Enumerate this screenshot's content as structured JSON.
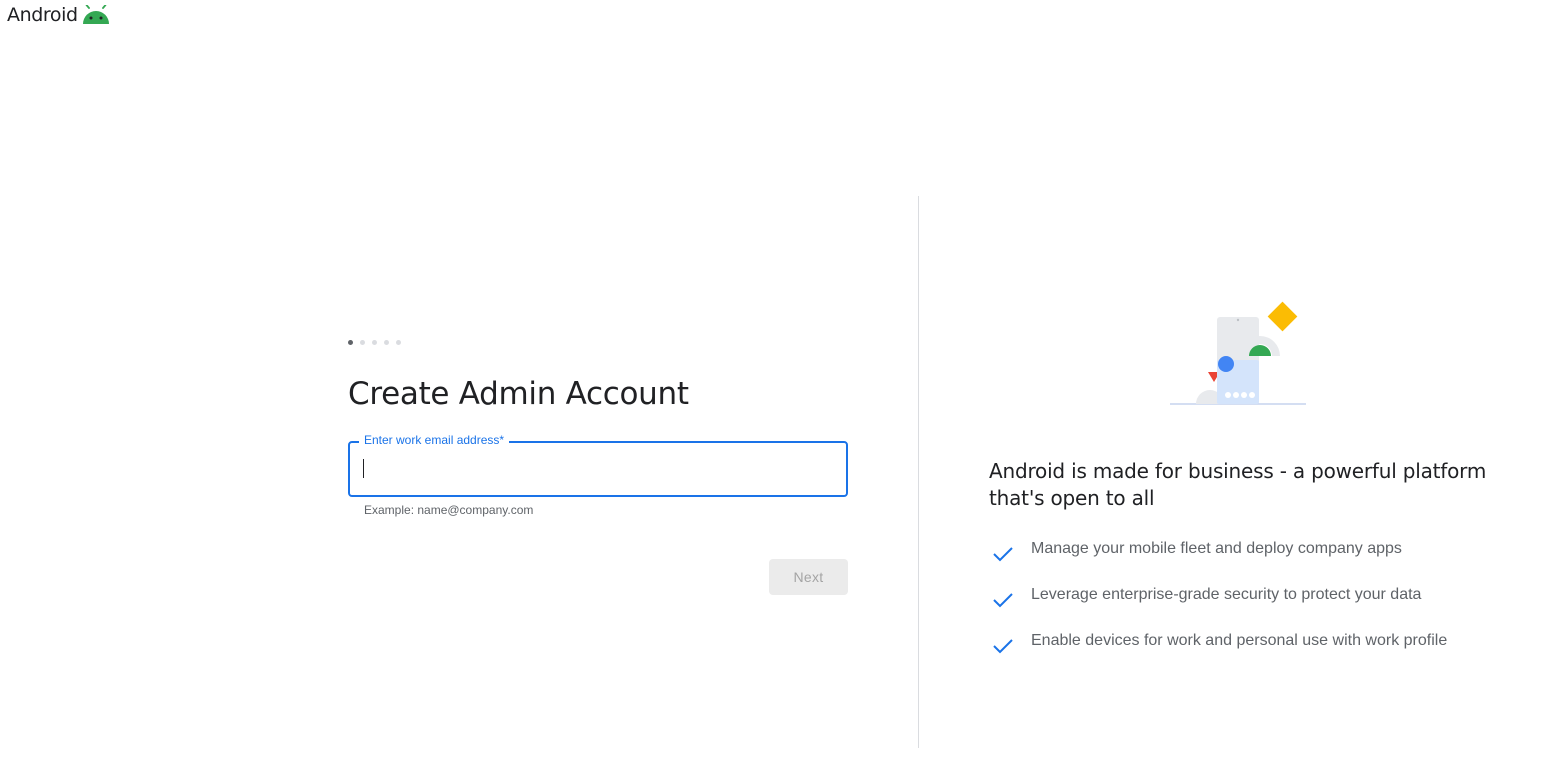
{
  "header": {
    "logo_text": "Android",
    "logo_icon": "android-bot-icon",
    "brand_color": "#34a853"
  },
  "form": {
    "stepper": {
      "total_steps": 5,
      "current_step": 1
    },
    "title": "Create Admin Account",
    "email_field": {
      "label": "Enter work email address*",
      "value": "",
      "placeholder": "",
      "helper": "Example: name@company.com"
    },
    "next_button": {
      "label": "Next",
      "enabled": false
    }
  },
  "promo": {
    "title": "Android is made for business - a powerful platform that's open to all",
    "features": [
      {
        "icon": "check-icon",
        "text": "Manage your mobile fleet and deploy company apps"
      },
      {
        "icon": "check-icon",
        "text": "Leverage enterprise-grade security to protect your data"
      },
      {
        "icon": "check-icon",
        "text": "Enable devices for work and personal use with work profile"
      }
    ]
  },
  "colors": {
    "accent": "#1a73e8",
    "text_primary": "#202124",
    "text_secondary": "#5f6368",
    "divider": "#dadce0",
    "button_disabled_bg": "#ebebeb",
    "button_disabled_text": "#a4a4a4"
  }
}
